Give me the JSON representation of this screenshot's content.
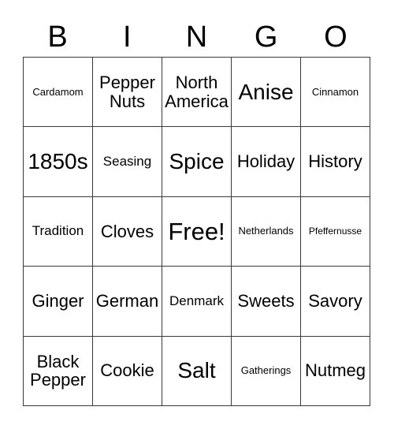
{
  "card": {
    "type": "bingo-card",
    "title": "BINGO",
    "columns": 5,
    "rows": 5,
    "free_space": {
      "row": 3,
      "column": 3,
      "label": "Free!"
    },
    "colors": {
      "background": "#ffffff",
      "text": "#000000",
      "grid_line": "#3a3a3a"
    }
  },
  "header": {
    "letters": [
      {
        "label": "B"
      },
      {
        "label": "I"
      },
      {
        "label": "N"
      },
      {
        "label": "G"
      },
      {
        "label": "O"
      }
    ]
  },
  "grid": {
    "cells": [
      {
        "label": "Cardamom",
        "size": "fs-xs",
        "free": false
      },
      {
        "label": "Pepper\nNuts",
        "size": "fs-md",
        "free": false
      },
      {
        "label": "North\nAmerica",
        "size": "fs-md",
        "free": false
      },
      {
        "label": "Anise",
        "size": "fs-lg",
        "free": false
      },
      {
        "label": "Cinnamon",
        "size": "fs-xs",
        "free": false
      },
      {
        "label": "1850s",
        "size": "fs-lg",
        "free": false
      },
      {
        "label": "Seasing",
        "size": "fs-sm",
        "free": false
      },
      {
        "label": "Spice",
        "size": "fs-lg",
        "free": false
      },
      {
        "label": "Holiday",
        "size": "fs-md",
        "free": false
      },
      {
        "label": "History",
        "size": "fs-md",
        "free": false
      },
      {
        "label": "Tradition",
        "size": "fs-sm",
        "free": false
      },
      {
        "label": "Cloves",
        "size": "fs-md",
        "free": false
      },
      {
        "label": "Free!",
        "size": "fs-xl",
        "free": true
      },
      {
        "label": "Netherlands",
        "size": "fs-xs",
        "free": false
      },
      {
        "label": "Pfeffernusse",
        "size": "fs-xxs",
        "free": false
      },
      {
        "label": "Ginger",
        "size": "fs-md",
        "free": false
      },
      {
        "label": "German",
        "size": "fs-md",
        "free": false
      },
      {
        "label": "Denmark",
        "size": "fs-sm",
        "free": false
      },
      {
        "label": "Sweets",
        "size": "fs-md",
        "free": false
      },
      {
        "label": "Savory",
        "size": "fs-md",
        "free": false
      },
      {
        "label": "Black\nPepper",
        "size": "fs-md",
        "free": false
      },
      {
        "label": "Cookie",
        "size": "fs-md",
        "free": false
      },
      {
        "label": "Salt",
        "size": "fs-lg",
        "free": false
      },
      {
        "label": "Gatherings",
        "size": "fs-xs",
        "free": false
      },
      {
        "label": "Nutmeg",
        "size": "fs-md",
        "free": false
      }
    ]
  }
}
